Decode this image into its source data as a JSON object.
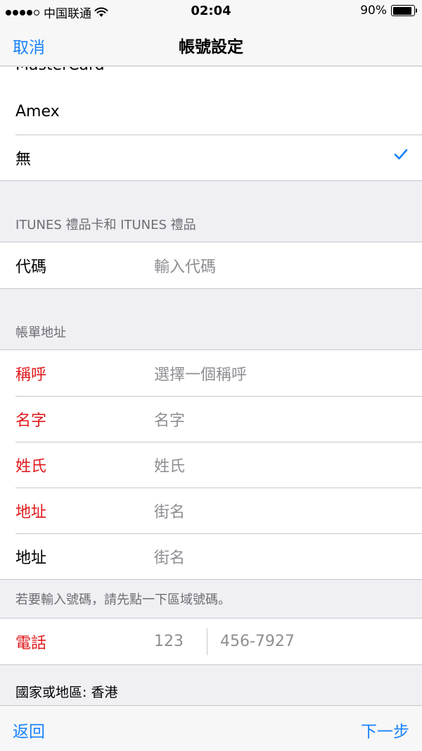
{
  "status_bar": {
    "carrier": "中国联通",
    "time": "02:04",
    "battery": "90%",
    "battery_level": 0.9
  },
  "nav": {
    "cancel_label": "取消",
    "title": "帳號設定"
  },
  "payment": {
    "partial_item": "MasterCard",
    "items": [
      {
        "label": "Amex",
        "selected": false
      },
      {
        "label": "無",
        "selected": true
      }
    ]
  },
  "itunes": {
    "header": "ITUNES 禮品卡和 ITUNES 禮品",
    "code_label": "代碼",
    "code_placeholder": "輸入代碼"
  },
  "billing": {
    "header": "帳單地址",
    "rows": [
      {
        "label": "稱呼",
        "placeholder": "選擇一個稱呼",
        "required": true
      },
      {
        "label": "名字",
        "placeholder": "名字",
        "required": true
      },
      {
        "label": "姓氏",
        "placeholder": "姓氏",
        "required": true
      },
      {
        "label": "地址",
        "placeholder": "街名",
        "required": true
      },
      {
        "label": "地址",
        "placeholder": "街名",
        "required": false
      }
    ],
    "phone_note": "若要輸入號碼，請先點一下區域號碼。",
    "phone_label": "電話",
    "phone_area_placeholder": "123",
    "phone_number_placeholder": "456-7927",
    "country": "國家或地區: 香港"
  },
  "toolbar": {
    "back_label": "返回",
    "next_label": "下一步"
  },
  "colors": {
    "accent": "#1a82fb",
    "required": "#e0191c"
  }
}
